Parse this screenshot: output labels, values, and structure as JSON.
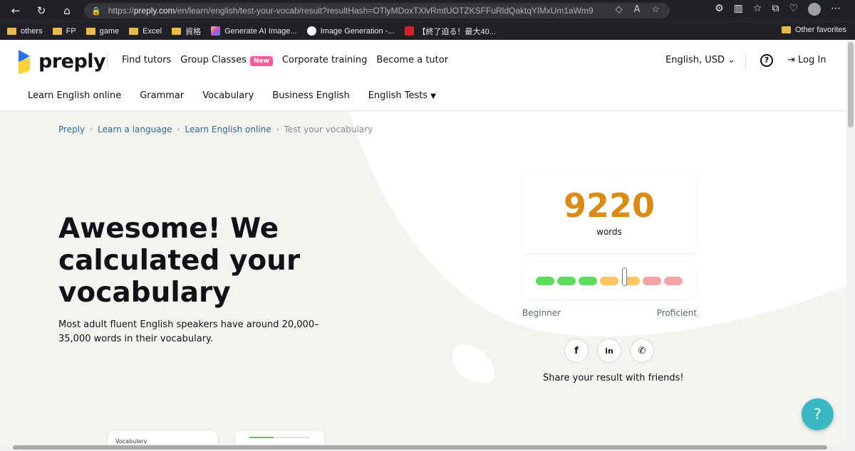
{
  "browser": {
    "url_host": "preply.com",
    "url_prefix": "https://",
    "url_rest": "/en/learn/english/test-your-vocab/result?resultHash=OTlyMDoxTXlvRmtUOTZKSFFuRldQaktqYlMxUm1aWm9fSDZW...",
    "bookmarks": [
      {
        "label": "others",
        "type": "folder"
      },
      {
        "label": "FP",
        "type": "folder"
      },
      {
        "label": "game",
        "type": "folder"
      },
      {
        "label": "Excel",
        "type": "folder"
      },
      {
        "label": "資格",
        "type": "folder"
      },
      {
        "label": "Generate AI Image...",
        "type": "site",
        "color": "#c94ad6"
      },
      {
        "label": "Image Generation -...",
        "type": "site",
        "color": "#ffffff"
      },
      {
        "label": "【終了迫る！最大40...",
        "type": "site",
        "color": "#d21f26"
      }
    ],
    "other_favorites": "Other favorites"
  },
  "header": {
    "logo_text": "preply",
    "nav": {
      "find_tutors": "Find tutors",
      "group_classes": "Group Classes",
      "new_badge": "New",
      "corporate": "Corporate training",
      "become_tutor": "Become a tutor"
    },
    "language": "English, USD",
    "help": "?",
    "login": "Log In",
    "subnav": {
      "learn_english": "Learn English online",
      "grammar": "Grammar",
      "vocabulary": "Vocabulary",
      "business": "Business English",
      "tests": "English Tests"
    }
  },
  "breadcrumb": {
    "preply": "Preply",
    "learn_language": "Learn a language",
    "learn_english": "Learn English online",
    "current": "Test your vocabulary"
  },
  "hero": {
    "title": "Awesome! We calculated your vocabulary",
    "subtitle": "Most adult fluent English speakers have around 20,000–35,000 words in their vocabulary."
  },
  "result": {
    "count": "9220",
    "unit": "words",
    "level_min": "Beginner",
    "level_max": "Proficient",
    "scale_position": 0.6,
    "scale_colors": [
      "#5ddc5d",
      "#5ddc5d",
      "#5ddc5d",
      "#ffc55e",
      "#ffc55e",
      "#f3a5a5",
      "#f3a5a5"
    ]
  },
  "share": {
    "text": "Share your result with friends!",
    "facebook": "f",
    "linkedin": "in",
    "whatsapp": "✆"
  },
  "fab": "?",
  "mini_card_label": "Vocabulary"
}
